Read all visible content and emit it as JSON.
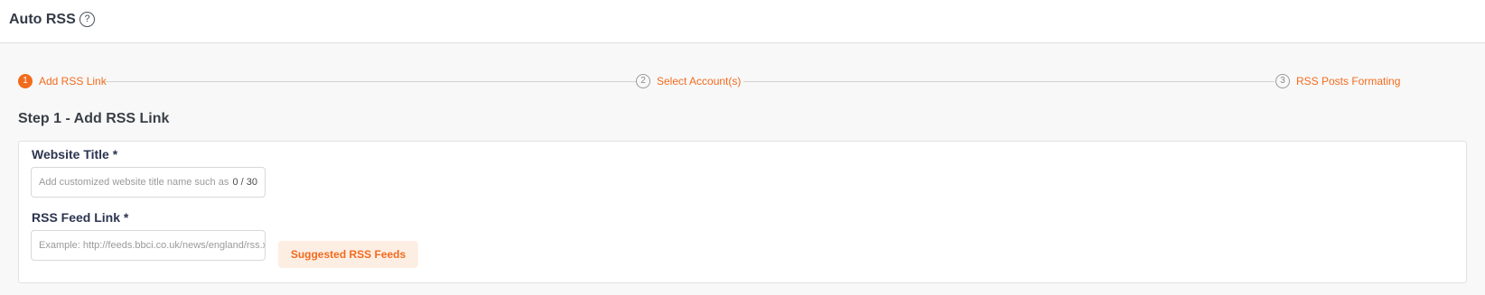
{
  "header": {
    "title": "Auto RSS",
    "help_icon": "help-circle-icon",
    "help_glyph": "?"
  },
  "stepper": {
    "steps": [
      {
        "number": "1",
        "label": "Add RSS Link",
        "active": true
      },
      {
        "number": "2",
        "label": "Select Account(s)",
        "active": false
      },
      {
        "number": "3",
        "label": "RSS Posts Formating",
        "active": false
      }
    ]
  },
  "main": {
    "step_heading": "Step 1 - Add RSS Link",
    "website_title": {
      "label": "Website Title *",
      "value": "",
      "placeholder": "Add customized website title name such as BBC News",
      "counter": "0 / 30"
    },
    "rss_feed_link": {
      "label": "RSS Feed Link *",
      "value": "",
      "placeholder": "Example: http://feeds.bbci.co.uk/news/england/rss.xml"
    },
    "suggested_button_label": "Suggested RSS Feeds"
  },
  "colors": {
    "accent": "#f26b1d",
    "accent_light": "#fdeee4",
    "background": "#f8f8f8",
    "card": "#ffffff"
  }
}
